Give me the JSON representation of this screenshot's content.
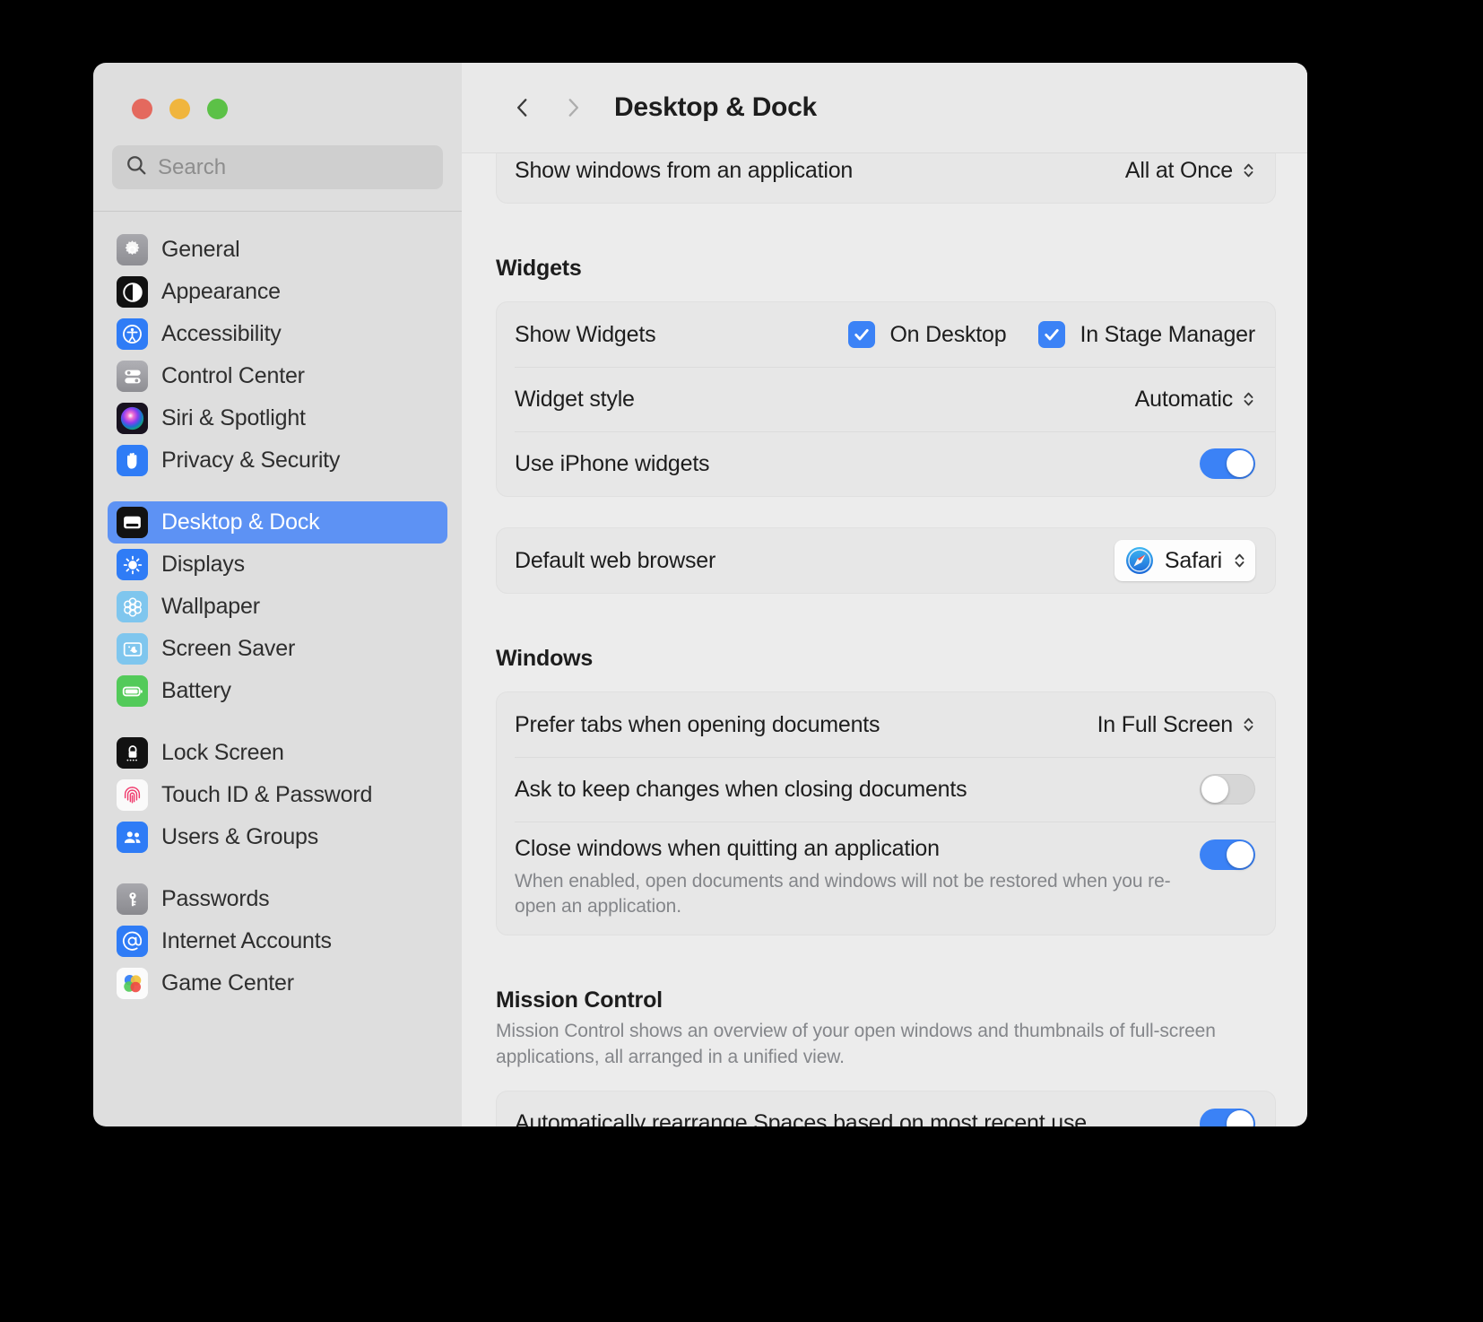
{
  "window": {
    "traffic_lights": [
      "close",
      "minimize",
      "zoom"
    ]
  },
  "search": {
    "placeholder": "Search",
    "value": "",
    "icon": "search-icon"
  },
  "sidebar": {
    "groups": [
      {
        "items": [
          {
            "label": "General",
            "icon": "gear-icon",
            "selected": false
          },
          {
            "label": "Appearance",
            "icon": "appearance-icon",
            "selected": false
          },
          {
            "label": "Accessibility",
            "icon": "accessibility-icon",
            "selected": false
          },
          {
            "label": "Control Center",
            "icon": "control-center-icon",
            "selected": false
          },
          {
            "label": "Siri & Spotlight",
            "icon": "siri-icon",
            "selected": false
          },
          {
            "label": "Privacy & Security",
            "icon": "hand-icon",
            "selected": false
          }
        ]
      },
      {
        "items": [
          {
            "label": "Desktop & Dock",
            "icon": "desktop-dock-icon",
            "selected": true
          },
          {
            "label": "Displays",
            "icon": "brightness-icon",
            "selected": false
          },
          {
            "label": "Wallpaper",
            "icon": "wallpaper-icon",
            "selected": false
          },
          {
            "label": "Screen Saver",
            "icon": "screen-saver-icon",
            "selected": false
          },
          {
            "label": "Battery",
            "icon": "battery-icon",
            "selected": false
          }
        ]
      },
      {
        "items": [
          {
            "label": "Lock Screen",
            "icon": "lock-icon",
            "selected": false
          },
          {
            "label": "Touch ID & Password",
            "icon": "fingerprint-icon",
            "selected": false
          },
          {
            "label": "Users & Groups",
            "icon": "users-icon",
            "selected": false
          }
        ]
      },
      {
        "items": [
          {
            "label": "Passwords",
            "icon": "key-icon",
            "selected": false
          },
          {
            "label": "Internet Accounts",
            "icon": "at-sign-icon",
            "selected": false
          },
          {
            "label": "Game Center",
            "icon": "game-center-icon",
            "selected": false
          }
        ]
      }
    ]
  },
  "header": {
    "back_icon": "chevron-left-icon",
    "forward_icon": "chevron-right-icon",
    "title": "Desktop & Dock"
  },
  "main": {
    "top_row": {
      "label": "Show windows from an application",
      "value": "All at Once"
    },
    "widgets": {
      "section_title": "Widgets",
      "show_widgets": {
        "label": "Show Widgets",
        "on_desktop": {
          "label": "On Desktop",
          "checked": true
        },
        "in_stage_manager": {
          "label": "In Stage Manager",
          "checked": true
        }
      },
      "widget_style": {
        "label": "Widget style",
        "value": "Automatic"
      },
      "use_iphone_widgets": {
        "label": "Use iPhone widgets",
        "enabled": true
      }
    },
    "default_browser": {
      "label": "Default web browser",
      "value": "Safari",
      "icon": "safari-icon"
    },
    "windows": {
      "section_title": "Windows",
      "prefer_tabs": {
        "label": "Prefer tabs when opening documents",
        "value": "In Full Screen"
      },
      "ask_to_keep": {
        "label": "Ask to keep changes when closing documents",
        "enabled": false
      },
      "close_windows": {
        "label": "Close windows when quitting an application",
        "description": "When enabled, open documents and windows will not be restored when you re-open an application.",
        "enabled": true
      }
    },
    "mission_control": {
      "section_title": "Mission Control",
      "description": "Mission Control shows an overview of your open windows and thumbnails of full-screen applications, all arranged in a unified view.",
      "auto_rearrange": {
        "label": "Automatically rearrange Spaces based on most recent use",
        "enabled": true
      }
    }
  },
  "colors": {
    "accent": "#3b82f6",
    "selection": "#5d92f4",
    "sidebar_bg": "#dedede",
    "detail_bg": "#ececec"
  }
}
